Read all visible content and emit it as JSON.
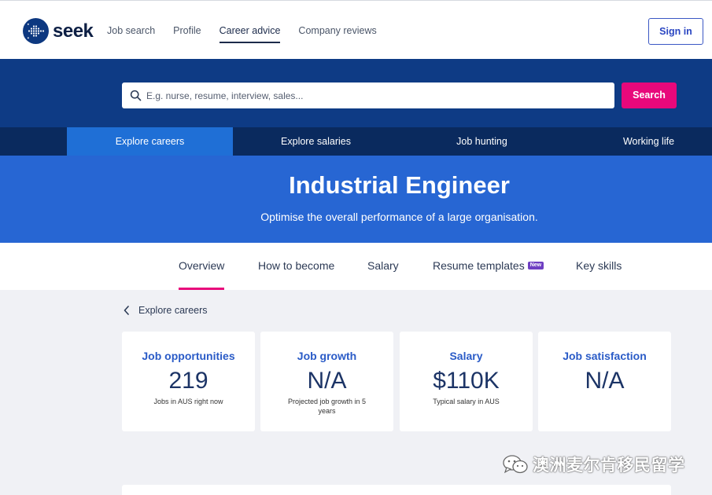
{
  "header": {
    "logo_text": "seek",
    "nav": [
      {
        "label": "Job search",
        "active": false
      },
      {
        "label": "Profile",
        "active": false
      },
      {
        "label": "Career advice",
        "active": true
      },
      {
        "label": "Company reviews",
        "active": false
      }
    ],
    "signin_label": "Sign in"
  },
  "search": {
    "placeholder": "E.g. nurse, resume, interview, sales...",
    "button_label": "Search"
  },
  "explore_tabs": [
    {
      "label": "Explore careers",
      "active": true
    },
    {
      "label": "Explore salaries",
      "active": false
    },
    {
      "label": "Job hunting",
      "active": false
    },
    {
      "label": "Working life",
      "active": false
    }
  ],
  "hero": {
    "title": "Industrial Engineer",
    "subtitle": "Optimise the overall performance of a large organisation."
  },
  "subtabs": [
    {
      "label": "Overview",
      "active": true
    },
    {
      "label": "How to become",
      "active": false
    },
    {
      "label": "Salary",
      "active": false
    },
    {
      "label": "Resume templates",
      "active": false,
      "badge": "New"
    },
    {
      "label": "Key skills",
      "active": false
    }
  ],
  "back_link": "Explore careers",
  "stats": [
    {
      "title": "Job opportunities",
      "value": "219",
      "note": "Jobs in AUS right now"
    },
    {
      "title": "Job growth",
      "value": "N/A",
      "note": "Projected job growth in 5 years"
    },
    {
      "title": "Salary",
      "value": "$110K",
      "note": "Typical salary in AUS"
    },
    {
      "title": "Job satisfaction",
      "value": "N/A",
      "note": ""
    }
  ],
  "watermark": {
    "text": "澳洲麦尔肯移民留学",
    "icon": "wechat-icon"
  },
  "colors": {
    "brand_navy": "#0e3b85",
    "explore_bar": "#0a2a5e",
    "hero_blue": "#2766d3",
    "active_tab": "#1f6fd6",
    "accent_pink": "#e8087b",
    "link_blue": "#2a5bc7"
  }
}
